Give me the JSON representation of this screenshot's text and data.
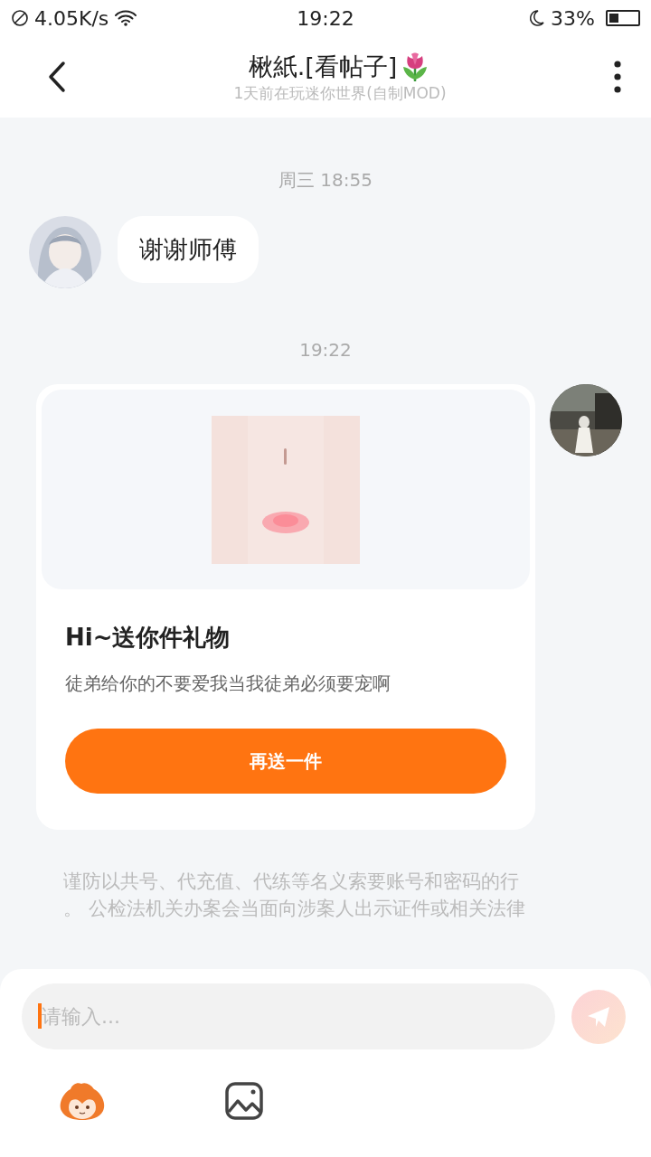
{
  "status_bar": {
    "speed": "4.05K/s",
    "time": "19:22",
    "battery": "33%"
  },
  "header": {
    "title": "楸紙.[看帖子]",
    "subtitle": "1天前在玩迷你世界(自制MOD)"
  },
  "messages": [
    {
      "kind": "time",
      "text": "周三 18:55"
    },
    {
      "kind": "text",
      "text": "谢谢师傅"
    },
    {
      "kind": "time",
      "text": "19:22"
    },
    {
      "kind": "gift",
      "title": "Hi~送你件礼物",
      "desc": "徒弟给你的不要爱我当我徒弟必须要宠啊",
      "button": "再送一件"
    }
  ],
  "notice": [
    "谨防以共号、代充值、代练等名义索要账号和密码的行",
    "。 公检法机关办案会当面向涉案人出示证件或相关法律"
  ],
  "composer": {
    "placeholder": "请输入..."
  }
}
